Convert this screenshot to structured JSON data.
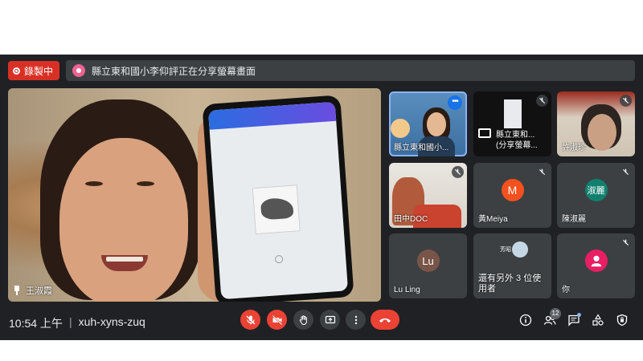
{
  "recording": {
    "label": "錄製中"
  },
  "share_banner": {
    "text": "縣立東和國小李仰評正在分享螢幕畫面"
  },
  "spotlight": {
    "name": "王淑霞"
  },
  "tiles": [
    {
      "name": "縣立東和國小...",
      "avatar_letter": "",
      "muted": false
    },
    {
      "name": "縣立東和...\n(分享螢幕...",
      "avatar_letter": "",
      "muted": true
    },
    {
      "name": "許淑珍",
      "avatar_letter": "",
      "muted": true
    },
    {
      "name": "田中DOC",
      "avatar_letter": "",
      "muted": true
    },
    {
      "name": "黃Meiya",
      "avatar_letter": "M",
      "muted": true
    },
    {
      "name": "陳淑麗",
      "avatar_letter": "淑麗",
      "muted": true
    },
    {
      "name": "Lu Ling",
      "avatar_letter": "Lu",
      "muted": false
    },
    {
      "name": "還有另外 3 位使用者",
      "avatar_letter": "芳昭",
      "muted": false
    },
    {
      "name": "你",
      "avatar_letter": "",
      "muted": true
    }
  ],
  "meeting": {
    "time": "10:54 上午",
    "code": "xuh-xyns-zuq",
    "participant_count": "12"
  },
  "colors": {
    "background": "#202124",
    "tile": "#3c4043",
    "red": "#ea4335",
    "accent": "#8ab4f8"
  },
  "icons": [
    "record-icon",
    "mic-off-icon",
    "camera-off-icon",
    "raise-hand-icon",
    "present-icon",
    "more-icon",
    "end-call-icon",
    "info-icon",
    "people-icon",
    "chat-icon",
    "activities-icon",
    "host-controls-icon",
    "pin-icon"
  ]
}
